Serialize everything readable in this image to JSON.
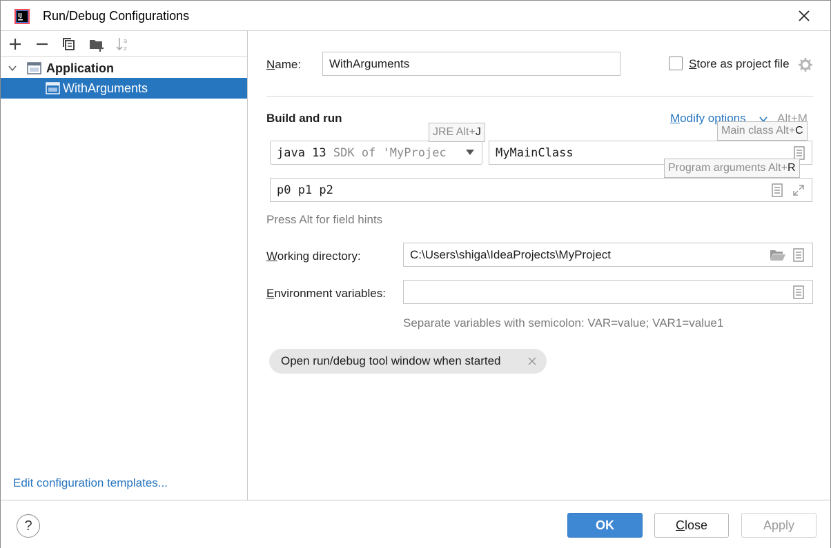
{
  "window": {
    "title": "Run/Debug Configurations"
  },
  "tree": {
    "group": "Application",
    "items": [
      {
        "label": "WithArguments"
      }
    ],
    "edit_templates": "Edit configuration templates..."
  },
  "form": {
    "name_label_u": "N",
    "name_label_rest": "ame:",
    "name_value": "WithArguments",
    "store_label_u": "S",
    "store_label_rest": "tore as project file",
    "build_and_run": "Build and run",
    "modify_options_u": "M",
    "modify_options_rest": "odify options",
    "modify_shortcut": "Alt+M",
    "jre_main": "java 13",
    "jre_sub": "SDK of 'MyProjec",
    "main_class": "MyMainClass",
    "program_args": "p0 p1 p2",
    "press_alt_hint": "Press Alt for field hints",
    "working_dir_label_u": "W",
    "working_dir_label_rest": "orking directory:",
    "working_dir_value": "C:\\Users\\shiga\\IdeaProjects\\MyProject",
    "env_label_u": "E",
    "env_label_rest": "nvironment variables:",
    "env_value": "",
    "env_hint": "Separate variables with semicolon: VAR=value; VAR1=value1",
    "chip_label": "Open run/debug tool window when started"
  },
  "tooltips": {
    "jre": {
      "text": "JRE Alt+",
      "key": "J"
    },
    "main_class": {
      "text": "Main class Alt+",
      "key": "C"
    },
    "program_args": {
      "text": "Program arguments Alt+",
      "key": "R"
    }
  },
  "buttons": {
    "ok": "OK",
    "close_u": "C",
    "close_rest": "lose",
    "apply": "Apply",
    "help": "?"
  },
  "colors": {
    "accent": "#2675bf",
    "ok_button": "#3e87d2",
    "chip": "#e6e6e6"
  }
}
